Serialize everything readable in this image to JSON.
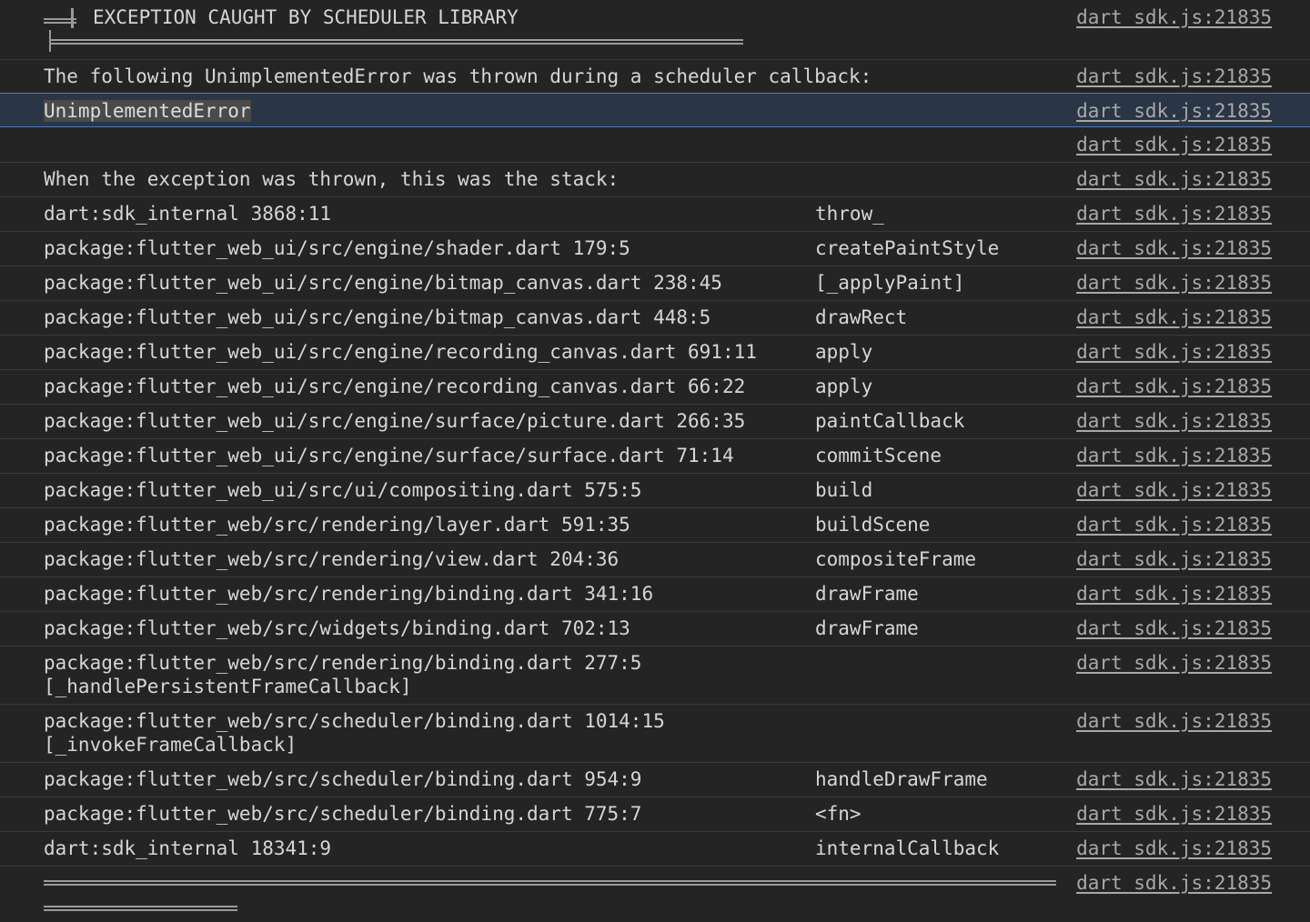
{
  "header": {
    "title": "EXCEPTION CAUGHT BY SCHEDULER LIBRARY",
    "source": "dart_sdk.js:21835"
  },
  "messages": {
    "intro": "The following UnimplementedError was thrown during a scheduler callback:",
    "intro_source": "dart_sdk.js:21835",
    "error": "UnimplementedError",
    "error_source": "dart_sdk.js:21835",
    "blank_source": "dart_sdk.js:21835",
    "stack_heading": "When the exception was thrown, this was the stack:",
    "stack_heading_source": "dart_sdk.js:21835"
  },
  "stack": [
    {
      "location": "dart:sdk_internal 3868:11",
      "function": "throw_",
      "source": "dart_sdk.js:21835"
    },
    {
      "location": "package:flutter_web_ui/src/engine/shader.dart 179:5",
      "function": "createPaintStyle",
      "source": "dart_sdk.js:21835"
    },
    {
      "location": "package:flutter_web_ui/src/engine/bitmap_canvas.dart 238:45",
      "function": "[_applyPaint]",
      "source": "dart_sdk.js:21835"
    },
    {
      "location": "package:flutter_web_ui/src/engine/bitmap_canvas.dart 448:5",
      "function": "drawRect",
      "source": "dart_sdk.js:21835"
    },
    {
      "location": "package:flutter_web_ui/src/engine/recording_canvas.dart 691:11",
      "function": "apply",
      "source": "dart_sdk.js:21835"
    },
    {
      "location": "package:flutter_web_ui/src/engine/recording_canvas.dart 66:22",
      "function": "apply",
      "source": "dart_sdk.js:21835"
    },
    {
      "location": "package:flutter_web_ui/src/engine/surface/picture.dart 266:35",
      "function": "paintCallback",
      "source": "dart_sdk.js:21835"
    },
    {
      "location": "package:flutter_web_ui/src/engine/surface/surface.dart 71:14",
      "function": "commitScene",
      "source": "dart_sdk.js:21835"
    },
    {
      "location": "package:flutter_web_ui/src/ui/compositing.dart 575:5",
      "function": "build",
      "source": "dart_sdk.js:21835"
    },
    {
      "location": "package:flutter_web/src/rendering/layer.dart 591:35",
      "function": "buildScene",
      "source": "dart_sdk.js:21835"
    },
    {
      "location": "package:flutter_web/src/rendering/view.dart 204:36",
      "function": "compositeFrame",
      "source": "dart_sdk.js:21835"
    },
    {
      "location": "package:flutter_web/src/rendering/binding.dart 341:16",
      "function": "drawFrame",
      "source": "dart_sdk.js:21835"
    },
    {
      "location": "package:flutter_web/src/widgets/binding.dart 702:13",
      "function": "drawFrame",
      "source": "dart_sdk.js:21835"
    },
    {
      "location": "package:flutter_web/src/rendering/binding.dart 277:5\n[_handlePersistentFrameCallback]",
      "function": "",
      "source": "dart_sdk.js:21835"
    },
    {
      "location": "package:flutter_web/src/scheduler/binding.dart 1014:15\n[_invokeFrameCallback]",
      "function": "",
      "source": "dart_sdk.js:21835"
    },
    {
      "location": "package:flutter_web/src/scheduler/binding.dart 954:9",
      "function": "handleDrawFrame",
      "source": "dart_sdk.js:21835"
    },
    {
      "location": "package:flutter_web/src/scheduler/binding.dart 775:7",
      "function": "<fn>",
      "source": "dart_sdk.js:21835"
    },
    {
      "location": "dart:sdk_internal 18341:9",
      "function": "internalCallback",
      "source": "dart_sdk.js:21835"
    }
  ],
  "footer": {
    "source": "dart_sdk.js:21835"
  },
  "colors": {
    "background": "#242424",
    "text": "#d6d6d6",
    "link": "#a8a8a8",
    "row_border": "#3a3a3a",
    "highlight_bg": "#2a3546",
    "highlight_border": "#4d7ab8"
  }
}
